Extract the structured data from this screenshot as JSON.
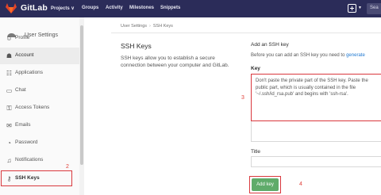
{
  "topbar": {
    "brand": "GitLab",
    "nav": [
      {
        "label": "Projects ∨"
      },
      {
        "label": "Groups"
      },
      {
        "label": "Activity"
      },
      {
        "label": "Milestones"
      },
      {
        "label": "Snippets"
      }
    ],
    "search_placeholder": "Sea",
    "brand_color": "#2b2c59"
  },
  "sidebar": {
    "header_label": "User Settings",
    "items": [
      {
        "label": "Profile",
        "icon": "profile-icon"
      },
      {
        "label": "Account",
        "icon": "account-icon"
      },
      {
        "label": "Applications",
        "icon": "applications-icon"
      },
      {
        "label": "Chat",
        "icon": "chat-icon"
      },
      {
        "label": "Access Tokens",
        "icon": "access-tokens-icon"
      },
      {
        "label": "Emails",
        "icon": "email-icon"
      },
      {
        "label": "Password",
        "icon": "password-icon"
      },
      {
        "label": "Notifications",
        "icon": "notifications-icon"
      },
      {
        "label": "SSH Keys",
        "icon": "key-icon"
      }
    ],
    "active_item": "Account"
  },
  "annotations": {
    "a2": "2",
    "a3": "3",
    "a4": "4",
    "color": "#e0403a"
  },
  "main": {
    "breadcrumb": [
      "User Settings",
      "SSH Keys"
    ],
    "section_title": "SSH Keys",
    "section_description": "SSH keys allow you to establish a secure connection between your computer and GitLab.",
    "add_title": "Add an SSH key",
    "add_note_text": "Before you can add an SSH key you need to",
    "add_note_link": "generate",
    "key_label": "Key",
    "key_placeholder": "Don't paste the private part of the SSH key. Paste the public part, which is usually contained in the file '~/.ssh/id_rsa.pub' and begins with 'ssh-rsa'.",
    "title_label": "Title",
    "add_key_button": "Add key",
    "button_color": "#5fab6a"
  }
}
